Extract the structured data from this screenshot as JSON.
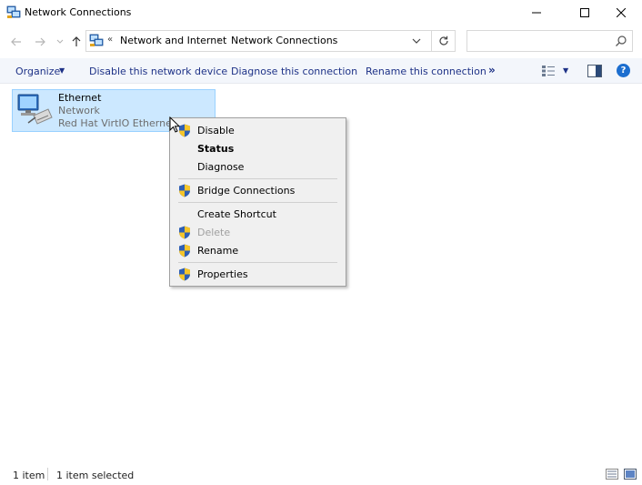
{
  "window": {
    "title": "Network Connections",
    "icon": "network-connections-icon"
  },
  "address": {
    "overflow_chevron": "«",
    "crumbs": [
      "Network and Internet",
      "Network Connections"
    ],
    "separator": "›",
    "search_placeholder": ""
  },
  "commandbar": {
    "organize": "Organize",
    "disable": "Disable this network device",
    "diagnose": "Diagnose this connection",
    "rename": "Rename this connection",
    "more": "»",
    "help": "?"
  },
  "item": {
    "name": "Ethernet",
    "status": "Network",
    "device": "Red Hat VirtIO Ethernet Adapter"
  },
  "context_menu": {
    "items": [
      {
        "label": "Disable",
        "shield": true,
        "disabled": false,
        "bold": false
      },
      {
        "label": "Status",
        "shield": false,
        "disabled": false,
        "bold": true
      },
      {
        "label": "Diagnose",
        "shield": false,
        "disabled": false,
        "bold": false
      },
      {
        "label": "Bridge Connections",
        "shield": true,
        "disabled": false,
        "bold": false
      },
      {
        "label": "Create Shortcut",
        "shield": false,
        "disabled": false,
        "bold": false
      },
      {
        "label": "Delete",
        "shield": true,
        "disabled": true,
        "bold": false
      },
      {
        "label": "Rename",
        "shield": true,
        "disabled": false,
        "bold": false
      },
      {
        "label": "Properties",
        "shield": true,
        "disabled": false,
        "bold": false
      }
    ]
  },
  "statusbar": {
    "count": "1 item",
    "selected": "1 item selected"
  },
  "colors": {
    "command_text": "#1e3287",
    "selection_bg": "#cce8ff",
    "selection_border": "#99d1ff",
    "menu_bg": "#f0f0f0",
    "help_blue": "#1c6ecf"
  }
}
